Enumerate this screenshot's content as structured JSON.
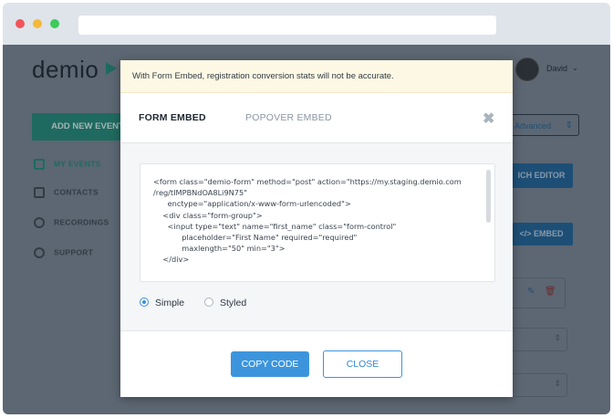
{
  "browser": {
    "traffic_lights": {
      "close": "#f2545b",
      "minimize": "#f5b938",
      "maximize": "#3bcb5a"
    },
    "url": ""
  },
  "app": {
    "logo": "demio",
    "add_event_label": "ADD NEW EVENT",
    "sidebar": [
      {
        "label": "MY EVENTS",
        "icon": "calendar-icon",
        "active": true
      },
      {
        "label": "CONTACTS",
        "icon": "contact-card-icon",
        "active": false
      },
      {
        "label": "RECORDINGS",
        "icon": "record-icon",
        "active": false
      },
      {
        "label": "SUPPORT",
        "icon": "lifebuoy-icon",
        "active": false
      }
    ],
    "user_name": "David",
    "advanced_label": "Advanced",
    "rich_editor_label": "ICH EDITOR",
    "embed_label": "</> EMBED"
  },
  "modal": {
    "warning": "With Form Embed, registration conversion stats will not be accurate.",
    "tabs": [
      {
        "label": "FORM EMBED",
        "active": true
      },
      {
        "label": "POPOVER EMBED",
        "active": false
      }
    ],
    "code": "<form class=\"demio-form\" method=\"post\" action=\"https://my.staging.demio.com\n/reg/tIMPBNdOA8Li9N75\"\n      enctype=\"application/x-www-form-urlencoded\">\n    <div class=\"form-group\">\n      <input type=\"text\" name=\"first_name\" class=\"form-control\"\n            placeholder=\"First Name\" required=\"required\"\n            maxlength=\"50\" min=\"3\">\n    </div>",
    "options": [
      {
        "label": "Simple",
        "selected": true
      },
      {
        "label": "Styled",
        "selected": false
      }
    ],
    "copy_label": "COPY CODE",
    "close_label": "CLOSE"
  },
  "colors": {
    "accent": "#3c95dc",
    "warning_bg": "#fdf8e4",
    "overlay": "#5c6773"
  }
}
